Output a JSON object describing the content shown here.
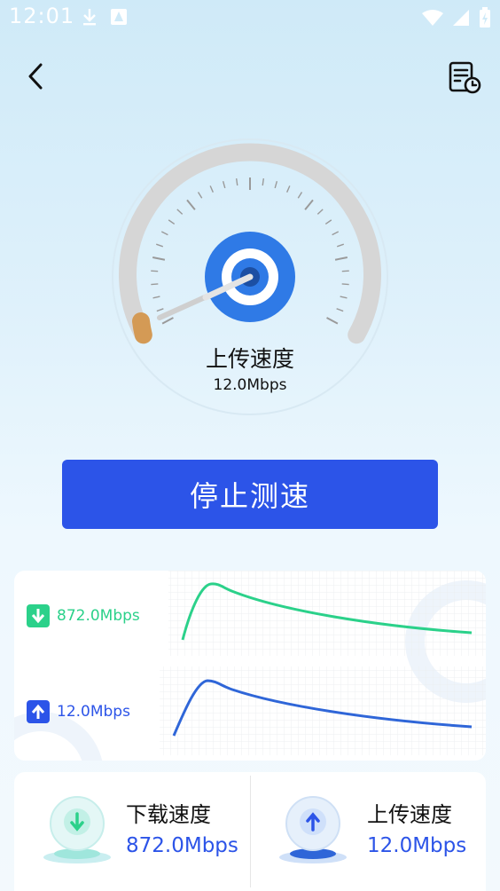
{
  "status_bar": {
    "time": "12:01"
  },
  "gauge": {
    "title": "上传速度",
    "value": "12.0Mbps"
  },
  "stop_button": {
    "label": "停止测速"
  },
  "chart": {
    "download_speed": "872.0Mbps",
    "upload_speed": "12.0Mbps"
  },
  "results": {
    "download_title": "下载速度",
    "download_value": "872.0Mbps",
    "upload_title": "上传速度",
    "upload_value": "12.0Mbps"
  },
  "colors": {
    "accent_blue": "#2c54e8",
    "download_green": "#2bd18a",
    "needle_tip": "#d49a55"
  },
  "icons": {
    "back": "chevron-left-icon",
    "history": "history-icon",
    "download": "arrow-down-icon",
    "upload": "arrow-up-icon"
  }
}
